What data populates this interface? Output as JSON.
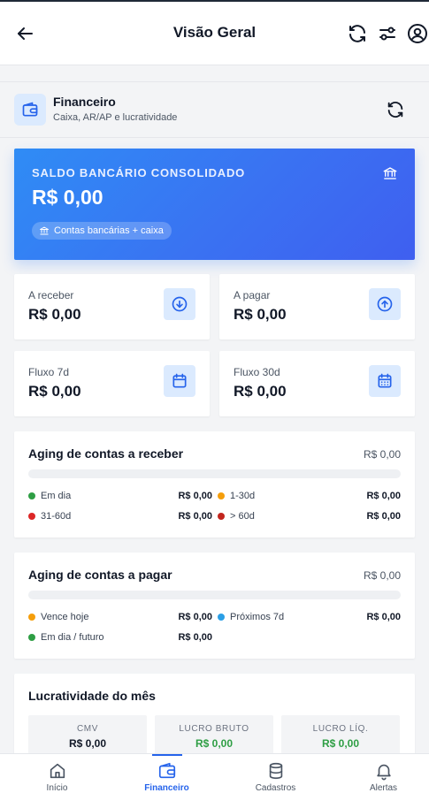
{
  "header": {
    "title": "Visão Geral"
  },
  "section": {
    "title": "Financeiro",
    "subtitle": "Caixa, AR/AP e lucratividade"
  },
  "balance": {
    "label": "SALDO BANCÁRIO CONSOLIDADO",
    "amount": "R$ 0,00",
    "pill": "Contas bancárias + caixa"
  },
  "stats": [
    {
      "label": "A receber",
      "value": "R$ 0,00",
      "icon": "arrow-down-circle-icon"
    },
    {
      "label": "A pagar",
      "value": "R$ 0,00",
      "icon": "arrow-up-circle-icon"
    },
    {
      "label": "Fluxo 7d",
      "value": "R$ 0,00",
      "icon": "calendar-icon"
    },
    {
      "label": "Fluxo 30d",
      "value": "R$ 0,00",
      "icon": "calendar-grid-icon"
    }
  ],
  "aging_receber": {
    "title": "Aging de contas a receber",
    "total": "R$ 0,00",
    "buckets": [
      {
        "label": "Em dia",
        "value": "R$ 0,00",
        "color": "#2e9e44"
      },
      {
        "label": "1-30d",
        "value": "R$ 0,00",
        "color": "#f59e0b"
      },
      {
        "label": "31-60d",
        "value": "R$ 0,00",
        "color": "#dc2626"
      },
      {
        "label": "> 60d",
        "value": "R$ 0,00",
        "color": "#c2261d"
      }
    ]
  },
  "aging_pagar": {
    "title": "Aging de contas a pagar",
    "total": "R$ 0,00",
    "buckets": [
      {
        "label": "Vence hoje",
        "value": "R$ 0,00",
        "color": "#f59e0b"
      },
      {
        "label": "Próximos 7d",
        "value": "R$ 0,00",
        "color": "#2b9fe6"
      },
      {
        "label": "Em dia / futuro",
        "value": "R$ 0,00",
        "color": "#2e9e44"
      }
    ]
  },
  "profit": {
    "title": "Lucratividade do mês",
    "cards": [
      {
        "label": "CMV",
        "value": "R$ 0,00",
        "color": "#111827"
      },
      {
        "label": "LUCRO BRUTO",
        "value": "R$ 0,00",
        "color": "#2e9e44"
      },
      {
        "label": "LUCRO LÍQ.",
        "value": "R$ 0,00",
        "color": "#2e9e44"
      }
    ]
  },
  "nav": [
    {
      "label": "Início",
      "icon": "home-icon"
    },
    {
      "label": "Financeiro",
      "icon": "wallet-icon",
      "active": true
    },
    {
      "label": "Cadastros",
      "icon": "database-icon"
    },
    {
      "label": "Alertas",
      "icon": "bell-icon"
    }
  ],
  "colors": {
    "accent": "#2563eb",
    "balance_card": "#3a72f2",
    "icon_bg": "#dbeafe",
    "positive": "#2e9e44"
  }
}
